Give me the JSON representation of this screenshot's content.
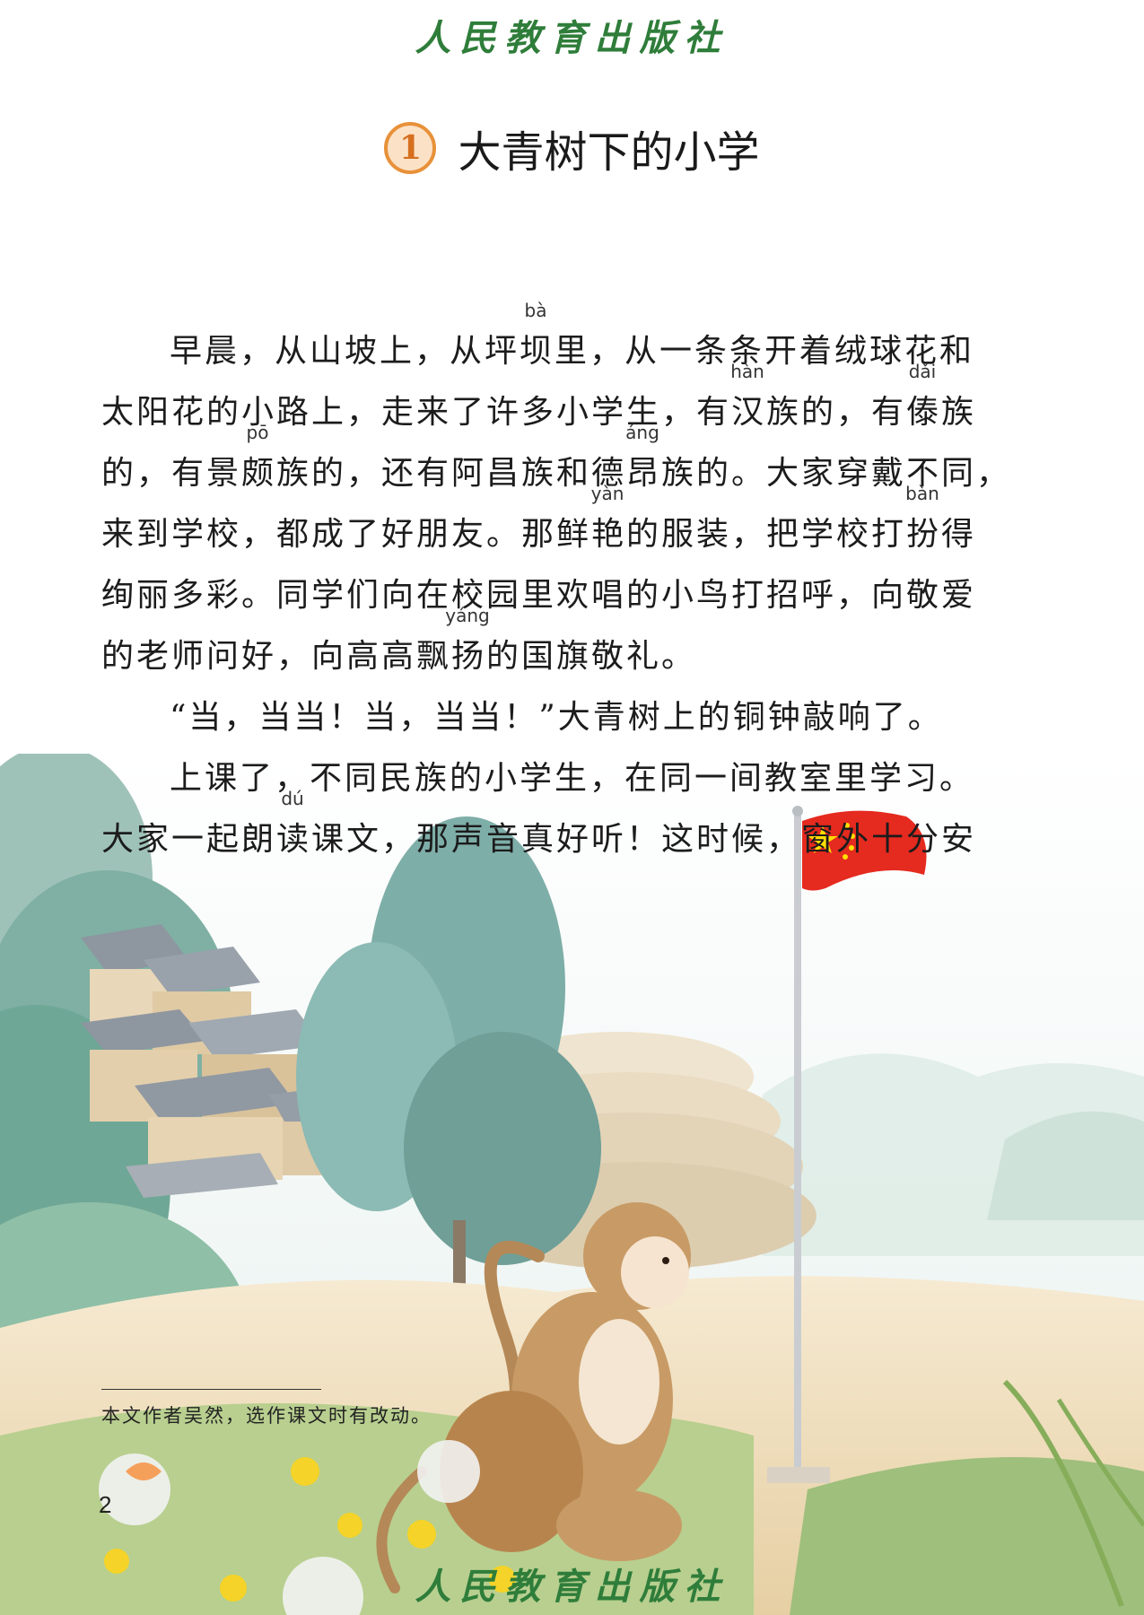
{
  "publisher": "人民教育出版社",
  "lesson": {
    "number": "1",
    "title": "大青树下的小学"
  },
  "lines": [
    {
      "text": "早晨，从山坡上，从坪坝里，从一条条开着绒球花和",
      "indent": true,
      "pinyin": [
        {
          "label": "bà",
          "char_index": 10
        }
      ]
    },
    {
      "text": "太阳花的小路上，走来了许多小学生，有汉族的，有傣族",
      "indent": false,
      "pinyin": [
        {
          "label": "hàn",
          "char_index": 18
        },
        {
          "label": "dǎi",
          "char_index": 23
        }
      ]
    },
    {
      "text": "的，有景颇族的，还有阿昌族和德昂族的。大家穿戴不同，",
      "indent": false,
      "pinyin": [
        {
          "label": "pō",
          "char_index": 4
        },
        {
          "label": "áng",
          "char_index": 15
        }
      ]
    },
    {
      "text": "来到学校，都成了好朋友。那鲜艳的服装，把学校打扮得",
      "indent": false,
      "pinyin": [
        {
          "label": "yàn",
          "char_index": 14
        },
        {
          "label": "bàn",
          "char_index": 23
        }
      ]
    },
    {
      "text": "绚丽多彩。同学们向在校园里欢唱的小鸟打招呼，向敬爱",
      "indent": false,
      "pinyin": []
    },
    {
      "text": "的老师问好，向高高飘扬的国旗敬礼。",
      "indent": false,
      "pinyin": [
        {
          "label": "yáng",
          "char_index": 10
        }
      ]
    },
    {
      "text": "“当，当当！当，当当！”大青树上的铜钟敲响了。",
      "indent": true,
      "pinyin": []
    },
    {
      "text": "上课了，不同民族的小学生，在同一间教室里学习。",
      "indent": true,
      "pinyin": []
    },
    {
      "text": "大家一起朗读课文，那声音真好听！这时候，窗外十分安",
      "indent": false,
      "pinyin": [
        {
          "label": "dú",
          "char_index": 5
        }
      ]
    }
  ],
  "footnote": "本文作者吴然，选作课文时有改动。",
  "page_number": "2",
  "colors": {
    "publisher_green": "#2f7d3a",
    "lesson_badge_orange": "#e8913a",
    "flag_red": "#e52a1f",
    "star_yellow": "#ffde00"
  }
}
